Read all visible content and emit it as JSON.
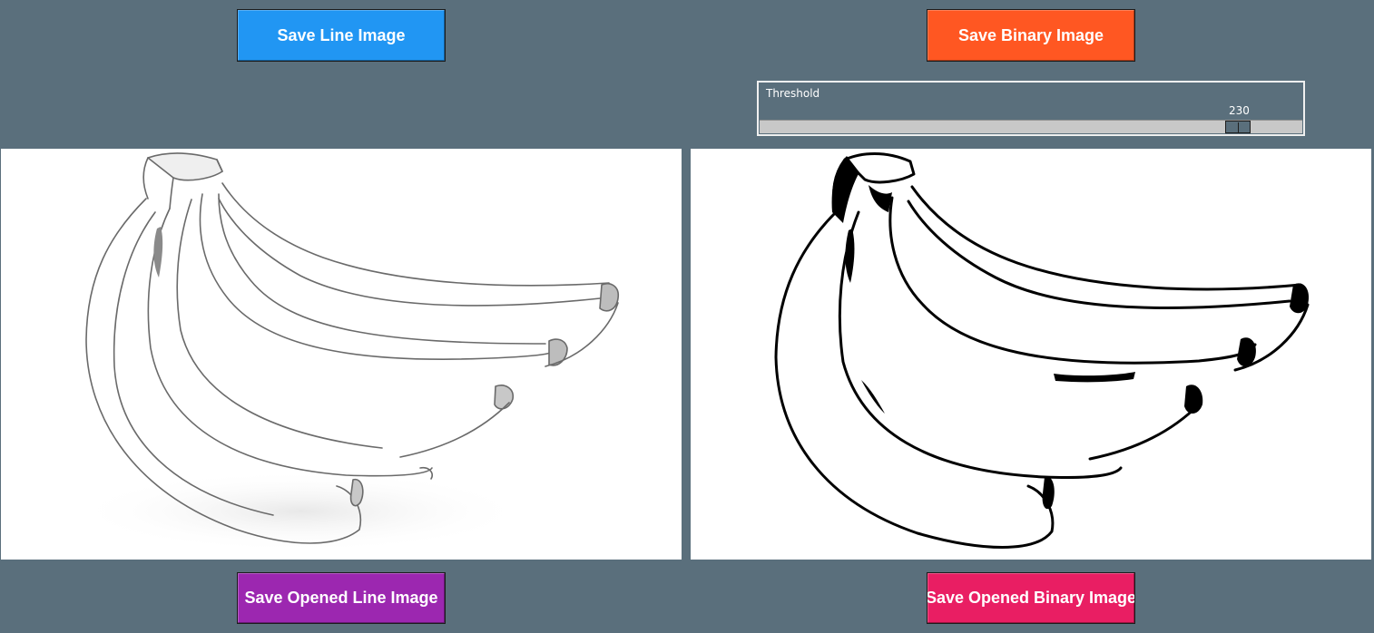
{
  "buttons": {
    "save_line": "Save Line Image",
    "save_binary": "Save Binary Image",
    "save_opened_line": "Save Opened Line Image",
    "save_opened_binary": "Save Opened Binary Image"
  },
  "threshold": {
    "label": "Threshold",
    "value": "230",
    "min": 0,
    "max": 255
  },
  "images": {
    "line_image": "banana-bunch-line-sketch",
    "binary_image": "banana-bunch-binary"
  },
  "colors": {
    "background": "#5a6f7c",
    "save_line": "#2196f3",
    "save_binary": "#ff5722",
    "save_opened_line": "#9c27b0",
    "save_opened_binary": "#e91e63"
  }
}
